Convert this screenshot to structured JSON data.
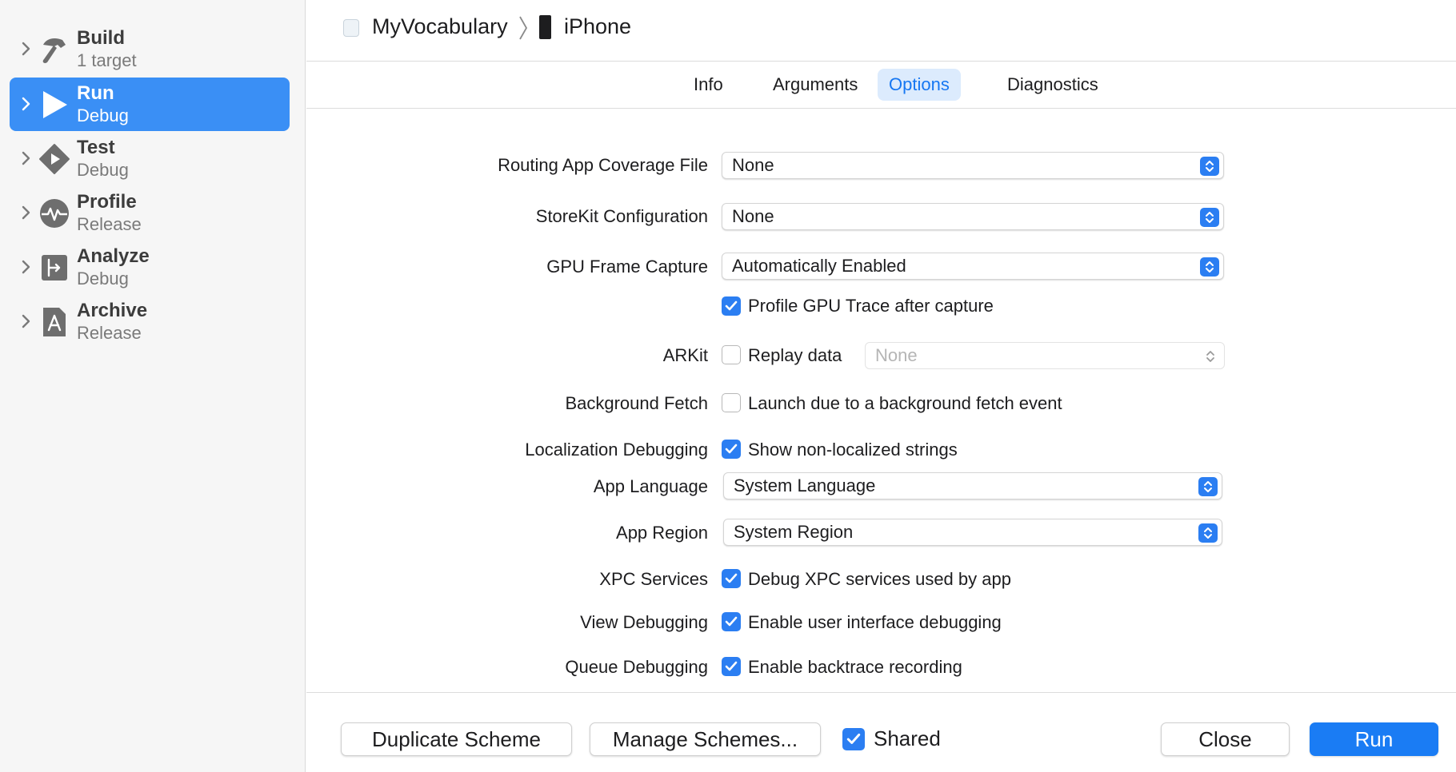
{
  "sidebar": {
    "items": [
      {
        "title": "Build",
        "subtitle": "1 target",
        "icon": "hammer-icon",
        "selected": false
      },
      {
        "title": "Run",
        "subtitle": "Debug",
        "icon": "play-icon",
        "selected": true
      },
      {
        "title": "Test",
        "subtitle": "Debug",
        "icon": "test-diamond-icon",
        "selected": false
      },
      {
        "title": "Profile",
        "subtitle": "Release",
        "icon": "pulse-icon",
        "selected": false
      },
      {
        "title": "Analyze",
        "subtitle": "Debug",
        "icon": "analyze-icon",
        "selected": false
      },
      {
        "title": "Archive",
        "subtitle": "Release",
        "icon": "archive-icon",
        "selected": false
      }
    ]
  },
  "header": {
    "scheme": "MyVocabulary",
    "device": "iPhone"
  },
  "tabs": [
    {
      "label": "Info",
      "active": false
    },
    {
      "label": "Arguments",
      "active": false
    },
    {
      "label": "Options",
      "active": true
    },
    {
      "label": "Diagnostics",
      "active": false
    }
  ],
  "options": {
    "routing_label": "Routing App Coverage File",
    "routing_value": "None",
    "storekit_label": "StoreKit Configuration",
    "storekit_value": "None",
    "gpu_label": "GPU Frame Capture",
    "gpu_value": "Automatically Enabled",
    "gpu_trace_label": "Profile GPU Trace after capture",
    "gpu_trace_checked": true,
    "arkit_label": "ARKit",
    "arkit_replay_label": "Replay data",
    "arkit_replay_checked": false,
    "arkit_replay_value": "None",
    "bgfetch_label": "Background Fetch",
    "bgfetch_check_label": "Launch due to a background fetch event",
    "bgfetch_checked": false,
    "loc_label": "Localization Debugging",
    "loc_check_label": "Show non-localized strings",
    "loc_checked": true,
    "lang_label": "App Language",
    "lang_value": "System Language",
    "region_label": "App Region",
    "region_value": "System Region",
    "xpc_label": "XPC Services",
    "xpc_check_label": "Debug XPC services used by app",
    "xpc_checked": true,
    "view_label": "View Debugging",
    "view_check_label": "Enable user interface debugging",
    "view_checked": true,
    "queue_label": "Queue Debugging",
    "queue_check_label": "Enable backtrace recording",
    "queue_checked": true
  },
  "footer": {
    "duplicate_label": "Duplicate Scheme",
    "manage_label": "Manage Schemes...",
    "shared_label": "Shared",
    "shared_checked": true,
    "close_label": "Close",
    "run_label": "Run"
  },
  "colors": {
    "accent": "#2b7ef2",
    "sidebar_selected": "#3a8ff5",
    "tab_active_bg": "#dcebfd"
  }
}
